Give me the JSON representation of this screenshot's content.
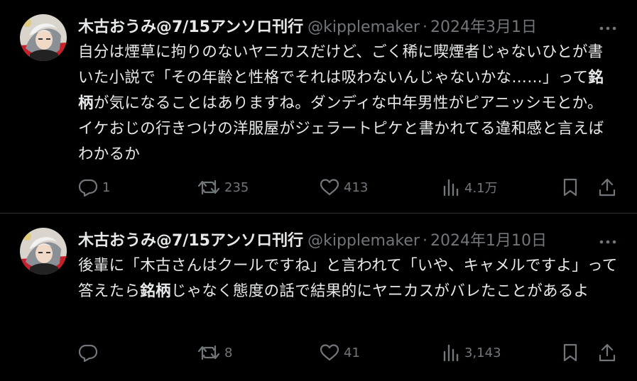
{
  "colors": {
    "background": "#000000",
    "text": "#e7e9ea",
    "muted": "#71767b",
    "divider": "#2f3336"
  },
  "tweets": [
    {
      "author_name": "木古おうみ@7/15アンソロ刊行",
      "handle": "@kipplemaker",
      "separator": "·",
      "date": "2024年3月1日",
      "text_parts": [
        "自分は煙草に拘りのないヤニカスだけど、ごく稀に喫煙者じゃないひとが書いた小説で「その年齢と性格でそれは吸わないんじゃないかな……」って",
        "銘柄",
        "が気になることはありますね。ダンディな中年男性がピアニッシモとか。イケおじの行きつけの洋服屋がジェラートピケと書かれてる違和感と言えばわかるか"
      ],
      "stats": {
        "replies": "1",
        "retweets": "235",
        "likes": "413",
        "views": "4.1万"
      },
      "icons": [
        "more-icon",
        "reply-icon",
        "retweet-icon",
        "like-icon",
        "views-icon",
        "bookmark-icon",
        "share-icon"
      ]
    },
    {
      "author_name": "木古おうみ@7/15アンソロ刊行",
      "handle": "@kipplemaker",
      "separator": "·",
      "date": "2024年1月10日",
      "text_parts": [
        "後輩に「木古さんはクールですね」と言われて「いや、キャメルですよ」って答えたら",
        "銘柄",
        "じゃなく態度の話で結果的にヤニカスがバレたことがあるよ"
      ],
      "stats": {
        "replies": "",
        "retweets": "8",
        "likes": "41",
        "views": "3,143"
      },
      "icons": [
        "more-icon",
        "reply-icon",
        "retweet-icon",
        "like-icon",
        "views-icon",
        "bookmark-icon",
        "share-icon"
      ]
    }
  ]
}
